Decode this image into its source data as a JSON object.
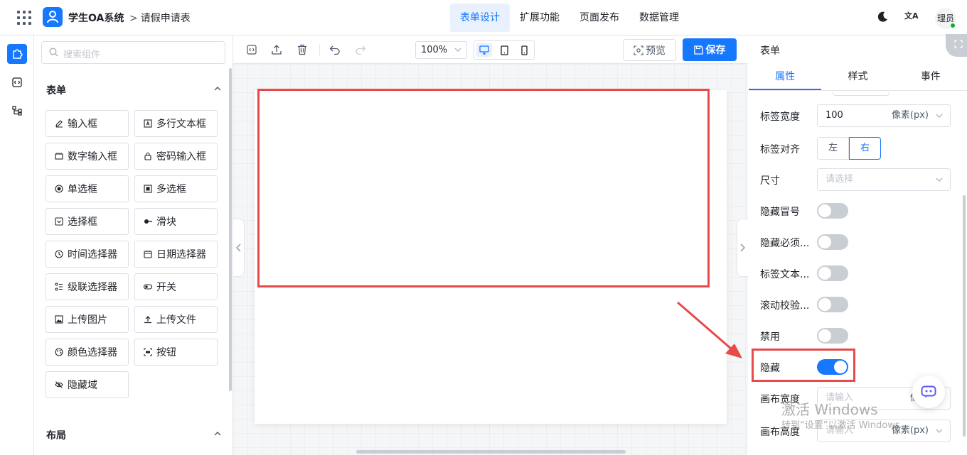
{
  "header": {
    "app_name": "学生OA系统",
    "breadcrumb_sep": ">",
    "breadcrumb": "请假申请表",
    "nav_tabs": [
      {
        "label": "表单设计",
        "active": true
      },
      {
        "label": "扩展功能",
        "active": false
      },
      {
        "label": "页面发布",
        "active": false
      },
      {
        "label": "数据管理",
        "active": false
      }
    ],
    "translate_glyph": "文A",
    "avatar_text": "理员",
    "accent_color": "#1677ff"
  },
  "left_panel": {
    "search_placeholder": "搜索组件",
    "group_form": "表单",
    "components": [
      {
        "label": "输入框",
        "icon": "pen-icon"
      },
      {
        "label": "多行文本框",
        "icon": "textarea-icon"
      },
      {
        "label": "数字输入框",
        "icon": "number-icon"
      },
      {
        "label": "密码输入框",
        "icon": "lock-icon"
      },
      {
        "label": "单选框",
        "icon": "radio-icon"
      },
      {
        "label": "多选框",
        "icon": "checkbox-icon"
      },
      {
        "label": "选择框",
        "icon": "select-icon"
      },
      {
        "label": "滑块",
        "icon": "slider-icon"
      },
      {
        "label": "时间选择器",
        "icon": "clock-icon"
      },
      {
        "label": "日期选择器",
        "icon": "calendar-icon"
      },
      {
        "label": "级联选择器",
        "icon": "cascader-icon"
      },
      {
        "label": "开关",
        "icon": "toggle-icon"
      },
      {
        "label": "上传图片",
        "icon": "image-icon"
      },
      {
        "label": "上传文件",
        "icon": "upload-icon"
      },
      {
        "label": "颜色选择器",
        "icon": "palette-icon"
      },
      {
        "label": "按钮",
        "icon": "button-icon"
      },
      {
        "label": "隐藏域",
        "icon": "eye-off-icon"
      }
    ],
    "group_layout": "布局"
  },
  "toolbar": {
    "zoom": "100%",
    "preview_label": "预览",
    "save_label": "保存"
  },
  "right_panel": {
    "title": "表单",
    "tabs": [
      {
        "label": "属性",
        "active": true
      },
      {
        "label": "样式",
        "active": false
      },
      {
        "label": "事件",
        "active": false
      }
    ],
    "label_width": {
      "label": "标签宽度",
      "value": "100",
      "unit": "像素(px)"
    },
    "label_align": {
      "label": "标签对齐",
      "options": [
        "左",
        "右"
      ],
      "selected": "右"
    },
    "size": {
      "label": "尺寸",
      "placeholder": "请选择"
    },
    "switches": [
      {
        "label": "隐藏冒号",
        "on": false
      },
      {
        "label": "隐藏必须...",
        "on": false
      },
      {
        "label": "标签文本...",
        "on": false
      },
      {
        "label": "滚动校验...",
        "on": false
      },
      {
        "label": "禁用",
        "on": false
      },
      {
        "label": "隐藏",
        "on": true
      }
    ],
    "canvas_width": {
      "label": "画布宽度",
      "placeholder": "请输入",
      "unit": "像素"
    },
    "canvas_height": {
      "label": "画布高度",
      "placeholder": "请输入",
      "unit": "像素(px)"
    }
  },
  "watermark": {
    "line1": "激活 Windows",
    "line2": "转到“设置”以激活 Windows。"
  }
}
